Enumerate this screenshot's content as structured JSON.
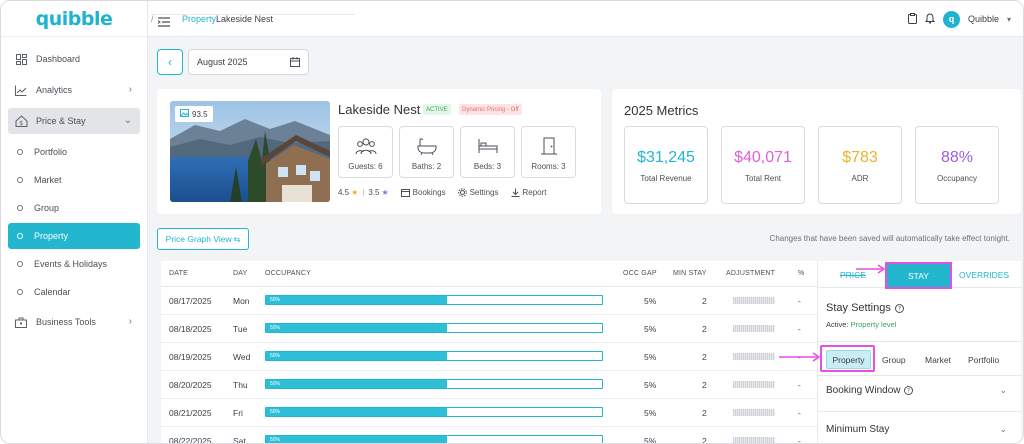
{
  "app": {
    "brand": "quibble"
  },
  "sidebar": {
    "items": [
      {
        "label": "Dashboard",
        "icon": "dashboard-icon"
      },
      {
        "label": "Analytics",
        "icon": "analytics-icon"
      },
      {
        "label": "Price & Stay",
        "icon": "price-stay-icon"
      }
    ],
    "sub_items": [
      "Portfolio",
      "Market",
      "Group",
      "Property",
      "Events & Holidays",
      "Calendar"
    ],
    "bottom_items": [
      {
        "label": "Business Tools",
        "icon": "business-tools-icon"
      }
    ]
  },
  "breadcrumb": {
    "parent": "Property",
    "current": "Lakeside Nest"
  },
  "user": {
    "name": "Quibble",
    "initial": "q"
  },
  "date_picker": {
    "value": "August 2025"
  },
  "property": {
    "name": "Lakeside Nest",
    "status_badge": "ACTIVE",
    "pricing_badge": "Dynamic Pricing - Off",
    "score": "93.5",
    "stats": {
      "guests": "Guests: 6",
      "baths": "Baths: 2",
      "beds": "Beds: 3",
      "rooms": "Rooms: 3"
    },
    "rating_1": "4.5",
    "rating_2": "3.5",
    "actions": {
      "bookings": "Bookings",
      "settings": "Settings",
      "report": "Report"
    }
  },
  "metrics": {
    "title": "2025 Metrics",
    "items": [
      {
        "value": "$31,245",
        "label": "Total Revenue",
        "color": "#22b6cf"
      },
      {
        "value": "$40,071",
        "label": "Total Rent",
        "color": "#e05fd6"
      },
      {
        "value": "$783",
        "label": "ADR",
        "color": "#e9b32a"
      },
      {
        "value": "88%",
        "label": "Occupancy",
        "color": "#9a5fe3"
      }
    ]
  },
  "graph_toggle": {
    "label": "Price Graph View"
  },
  "notice": "Changes that have been saved will automatically take effect tonight.",
  "table": {
    "headers": {
      "date": "DATE",
      "day": "DAY",
      "occupancy": "OCCUPANCY",
      "occ_gap": "OCC GAP",
      "min_stay": "MIN STAY",
      "adjustment": "ADJUSTMENT",
      "pct": "%"
    },
    "rows": [
      {
        "date": "08/17/2025",
        "day": "Mon",
        "occ_label": "50%",
        "occ_gap": "5%",
        "min_stay": "2",
        "pct": "-"
      },
      {
        "date": "08/18/2025",
        "day": "Tue",
        "occ_label": "50%",
        "occ_gap": "5%",
        "min_stay": "2",
        "pct": "-"
      },
      {
        "date": "08/19/2025",
        "day": "Wed",
        "occ_label": "50%",
        "occ_gap": "5%",
        "min_stay": "2",
        "pct": "-"
      },
      {
        "date": "08/20/2025",
        "day": "Thu",
        "occ_label": "50%",
        "occ_gap": "5%",
        "min_stay": "2",
        "pct": "-"
      },
      {
        "date": "08/21/2025",
        "day": "Fri",
        "occ_label": "50%",
        "occ_gap": "5%",
        "min_stay": "2",
        "pct": "-"
      },
      {
        "date": "08/22/2025",
        "day": "Sat",
        "occ_label": "50%",
        "occ_gap": "5%",
        "min_stay": "2",
        "pct": "-"
      }
    ],
    "occupancy_fraction": 0.54
  },
  "panel": {
    "tabs": {
      "price": "PRICE",
      "stay": "STAY",
      "overrides": "OVERRIDES"
    },
    "stay_settings": "Stay Settings",
    "active_label": "Active:",
    "active_value": "Property level",
    "scopes": [
      "Property",
      "Group",
      "Market",
      "Portfolio"
    ],
    "booking_window": "Booking Window",
    "minimum_stay": "Minimum Stay"
  },
  "colors": {
    "accent": "#22b6cf",
    "highlight": "#e64fe0"
  }
}
